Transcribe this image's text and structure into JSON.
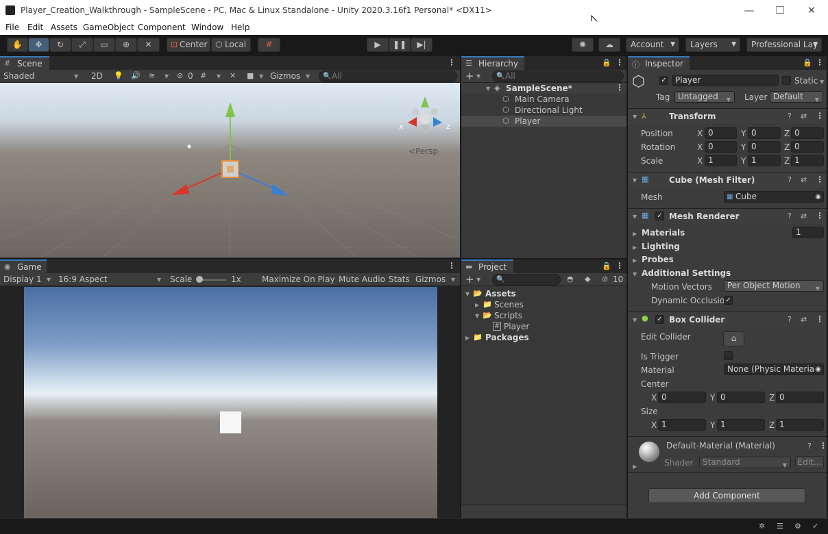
{
  "window": {
    "title": "Player_Creation_Walkthrough - SampleScene - PC, Mac & Linux Standalone - Unity 2020.3.16f1 Personal* <DX11>",
    "minimize": "—",
    "maximize": "☐",
    "close": "✕"
  },
  "menu": [
    "File",
    "Edit",
    "Assets",
    "GameObject",
    "Component",
    "Window",
    "Help"
  ],
  "toolbar": {
    "pivot": "Center",
    "space": "Local",
    "account": "Account",
    "layers": "Layers",
    "layout": "Professional Lay"
  },
  "scene": {
    "tab": "Scene",
    "shading": "Shaded",
    "mode2d": "2D",
    "hidden_count": "0",
    "gizmos": "Gizmos",
    "search_placeholder": "All",
    "axis_x": "x",
    "axis_z": "z",
    "projection": "Persp"
  },
  "game": {
    "tab": "Game",
    "display": "Display 1",
    "aspect": "16:9 Aspect",
    "scale_label": "Scale",
    "scale_value": "1x",
    "scale_level": 0,
    "maximize": "Maximize On Play",
    "mute": "Mute Audio",
    "stats": "Stats",
    "gizmos": "Gizmos"
  },
  "hierarchy": {
    "tab": "Hierarchy",
    "search_placeholder": "All",
    "scene": "SampleScene*",
    "items": [
      "Main Camera",
      "Directional Light",
      "Player"
    ]
  },
  "project": {
    "tab": "Project",
    "hidden_count": "10",
    "assets": "Assets",
    "scenes": "Scenes",
    "scripts": "Scripts",
    "player_script": "Player",
    "packages": "Packages",
    "script_icon": "#"
  },
  "inspector": {
    "tab": "Inspector",
    "name": "Player",
    "static": "Static",
    "tag_label": "Tag",
    "tag": "Untagged",
    "layer_label": "Layer",
    "layer": "Default",
    "transform": {
      "title": "Transform",
      "position": "Position",
      "rotation": "Rotation",
      "scale": "Scale",
      "x": "X",
      "y": "Y",
      "z": "Z",
      "pos": [
        "0",
        "0",
        "0"
      ],
      "rot": [
        "0",
        "0",
        "0"
      ],
      "scl": [
        "1",
        "1",
        "1"
      ]
    },
    "mesh_filter": {
      "title": "Cube (Mesh Filter)",
      "mesh_label": "Mesh",
      "mesh": "Cube"
    },
    "mesh_renderer": {
      "title": "Mesh Renderer",
      "materials": "Materials",
      "materials_count": "1",
      "lighting": "Lighting",
      "probes": "Probes",
      "additional": "Additional Settings",
      "motion_label": "Motion Vectors",
      "motion": "Per Object Motion",
      "dynamic": "Dynamic Occlusion"
    },
    "box_collider": {
      "title": "Box Collider",
      "edit": "Edit Collider",
      "trigger": "Is Trigger",
      "material_label": "Material",
      "material": "None (Physic Material)",
      "center": "Center",
      "size": "Size",
      "center_vals": [
        "0",
        "0",
        "0"
      ],
      "size_vals": [
        "1",
        "1",
        "1"
      ]
    },
    "material": {
      "title": "Default-Material (Material)",
      "shader_label": "Shader",
      "shader": "Standard",
      "edit": "Edit..."
    },
    "add_component": "Add Component"
  },
  "colors": {
    "accent": "#3a79bb",
    "panel": "#383838",
    "x_axis": "#d9352a",
    "y_axis": "#82c34a",
    "z_axis": "#3a7fd6"
  },
  "icons": {
    "hand": "hand-icon",
    "move": "move-icon",
    "rotate": "rotate-icon",
    "scale": "scale-icon",
    "rect": "rect-icon",
    "transform": "transform-icon",
    "custom": "custom-tool-icon",
    "grid": "grid-snap-icon",
    "play": "play-icon",
    "pause": "pause-icon",
    "step": "step-icon",
    "collab": "collab-icon",
    "cloud": "cloud-icon"
  }
}
